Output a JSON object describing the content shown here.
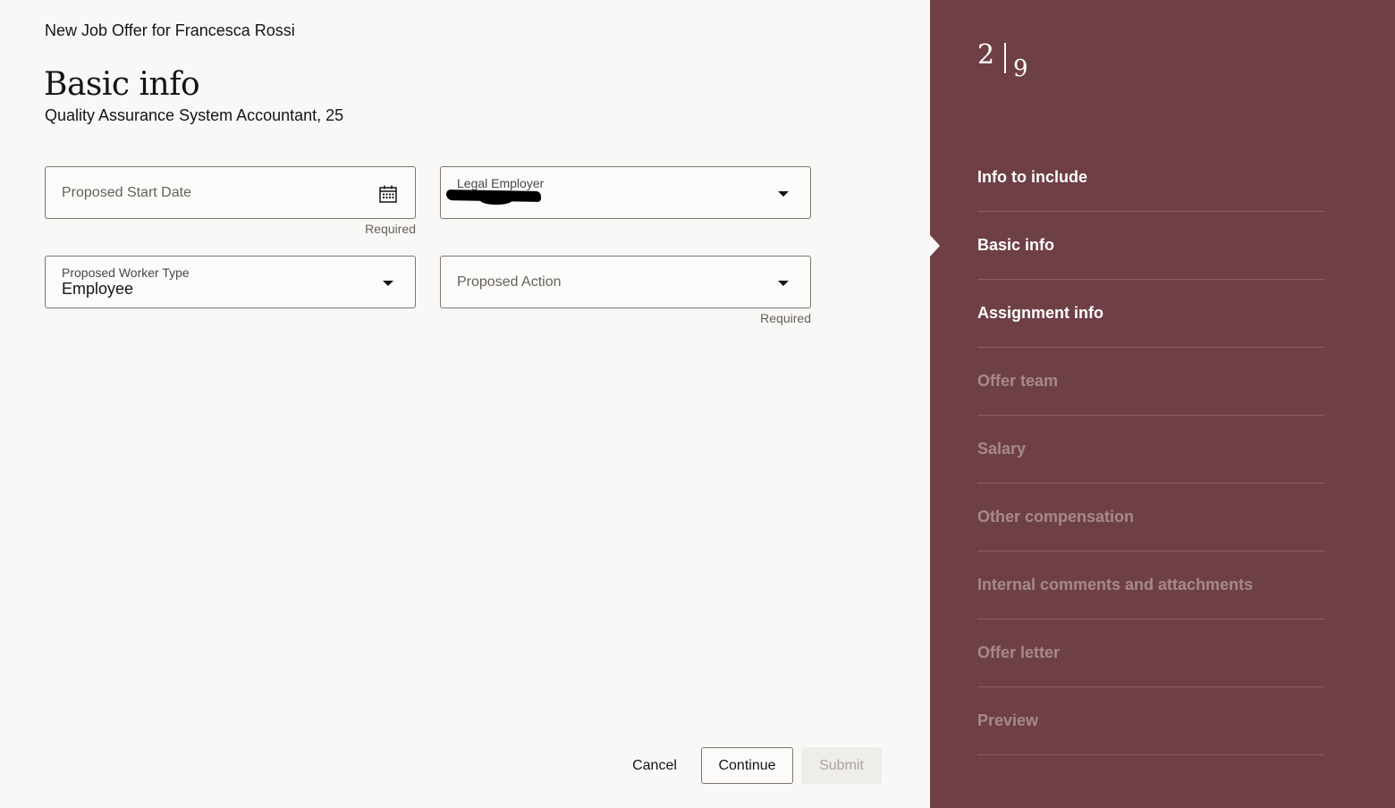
{
  "header": {
    "offer_title": "New Job Offer for Francesca Rossi",
    "page_title": "Basic info",
    "subtitle": "Quality Assurance System Accountant, 25"
  },
  "form": {
    "start_date": {
      "placeholder": "Proposed Start Date",
      "helper": "Required",
      "icon": "calendar-icon"
    },
    "legal_employer": {
      "label": "Legal Employer",
      "value_redacted": true,
      "icon": "chevron-down-icon"
    },
    "worker_type": {
      "label": "Proposed Worker Type",
      "value": "Employee",
      "icon": "chevron-down-icon"
    },
    "action": {
      "placeholder": "Proposed Action",
      "helper": "Required",
      "icon": "chevron-down-icon"
    }
  },
  "footer": {
    "cancel_label": "Cancel",
    "continue_label": "Continue",
    "submit_label": "Submit"
  },
  "side_panel": {
    "current_step": "2",
    "total_steps": "9",
    "background_color": "#6f3f46",
    "steps": [
      {
        "label": "Info to include",
        "state": "active"
      },
      {
        "label": "Basic info",
        "state": "current"
      },
      {
        "label": "Assignment info",
        "state": "active"
      },
      {
        "label": "Offer team",
        "state": "inactive"
      },
      {
        "label": "Salary",
        "state": "inactive"
      },
      {
        "label": "Other compensation",
        "state": "inactive"
      },
      {
        "label": "Internal comments and attachments",
        "state": "inactive"
      },
      {
        "label": "Offer letter",
        "state": "inactive"
      },
      {
        "label": "Preview",
        "state": "inactive"
      }
    ]
  }
}
